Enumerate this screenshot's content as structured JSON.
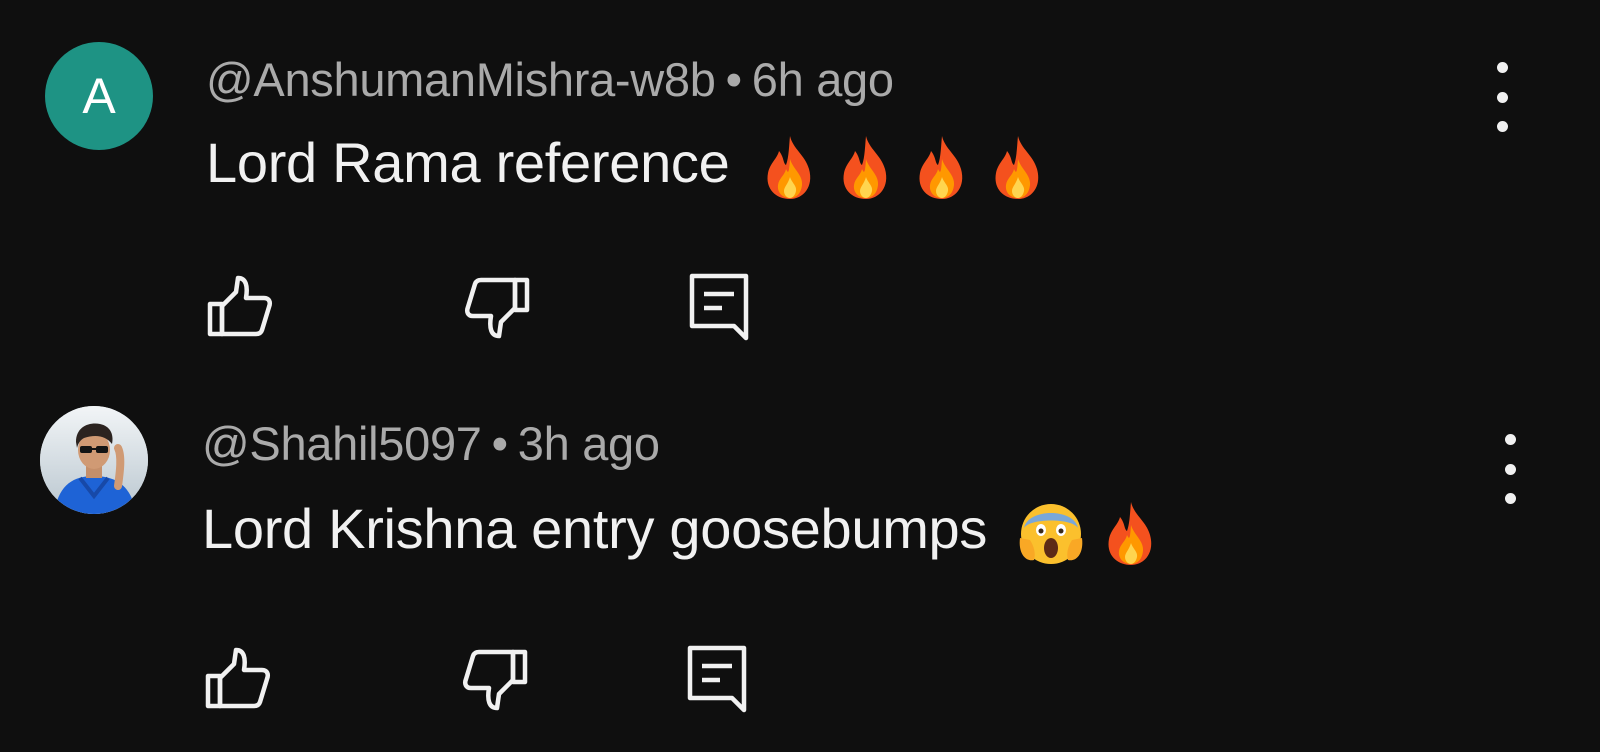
{
  "comments": [
    {
      "avatar_letter": "A",
      "avatar_color": "#1e9384",
      "username": "@AnshumanMishra-w8b",
      "separator": "•",
      "time": "6h ago",
      "text": "Lord Rama reference",
      "emojis": [
        "fire-emoji",
        "fire-emoji",
        "fire-emoji",
        "fire-emoji"
      ],
      "actions": [
        "thumbs-up-icon",
        "thumbs-down-icon",
        "reply-icon"
      ]
    },
    {
      "avatar_letter": "",
      "avatar_image": "profile-photo",
      "username": "@Shahil5097",
      "separator": "•",
      "time": "3h ago",
      "text": "Lord Krishna entry goosebumps",
      "emojis": [
        "screaming-face-emoji",
        "fire-emoji"
      ],
      "actions": [
        "thumbs-up-icon",
        "thumbs-down-icon",
        "reply-icon"
      ]
    }
  ],
  "colors": {
    "background": "#0f0f0f",
    "primary_text": "#f1f1f1",
    "secondary_text": "#aaaaaa"
  }
}
